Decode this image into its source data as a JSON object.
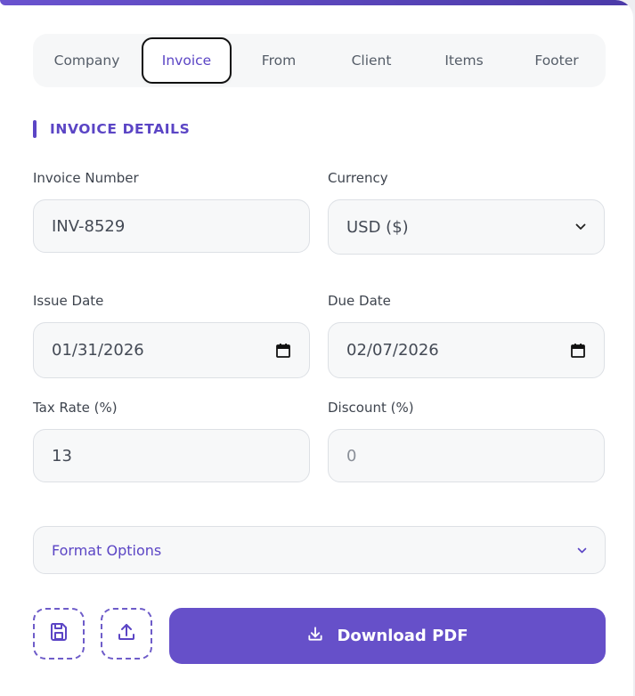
{
  "tabs": [
    "Company",
    "Invoice",
    "From",
    "Client",
    "Items",
    "Footer"
  ],
  "active_tab": "Invoice",
  "section": {
    "title": "INVOICE DETAILS"
  },
  "fields": {
    "invoice_number": {
      "label": "Invoice Number",
      "value": "INV-8529"
    },
    "currency": {
      "label": "Currency",
      "value": "USD ($)"
    },
    "issue_date": {
      "label": "Issue Date",
      "value": "01/31/2026"
    },
    "due_date": {
      "label": "Due Date",
      "value": "02/07/2026"
    },
    "tax_rate": {
      "label": "Tax Rate (%)",
      "value": "13"
    },
    "discount": {
      "label": "Discount (%)",
      "value": "0"
    }
  },
  "format_options": {
    "label": "Format Options"
  },
  "actions": {
    "download_label": "Download PDF"
  },
  "colors": {
    "accent": "#5b45c5",
    "button": "#6650c9",
    "field_bg": "#f7f8f9"
  },
  "icons": [
    "calendar-icon",
    "chevron-down-icon",
    "save-icon",
    "upload-icon",
    "download-icon"
  ]
}
